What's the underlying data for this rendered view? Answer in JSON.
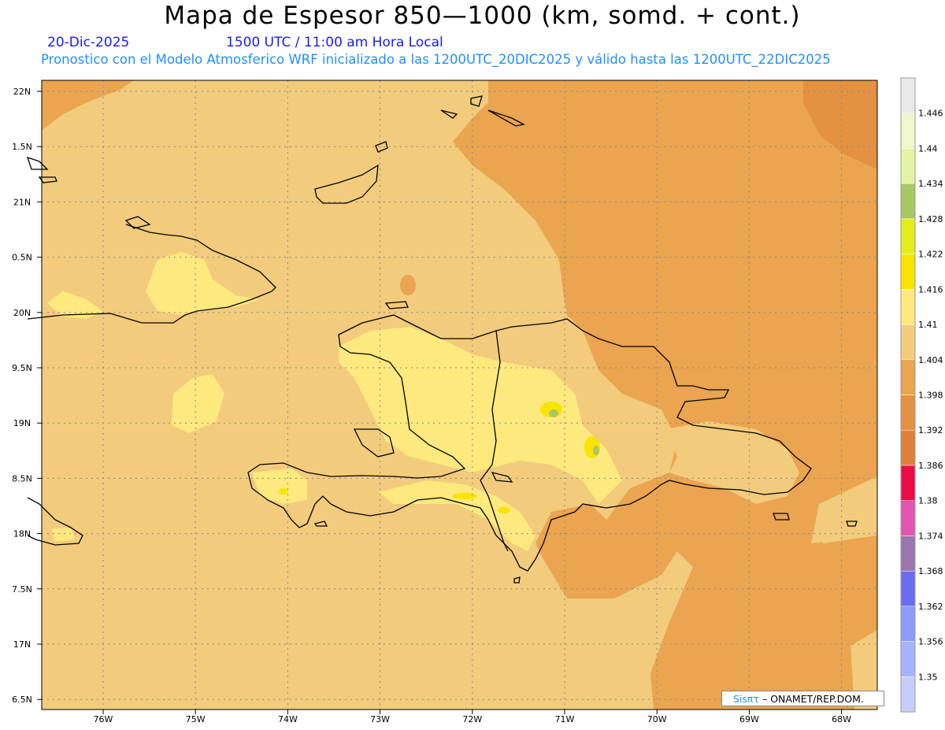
{
  "title": "Mapa de Espesor 850—1000 (km, somd. + cont.)",
  "date": "20-Dic-2025",
  "time": "1500 UTC / 11:00 am Hora Local",
  "description": "Pronostico con el Modelo Atmosferico WRF inicializado a las 1200UTC_20DIC2025 y válido hasta las  1200UTC_22DIC2025",
  "credit": {
    "prefix": "Sisπτ",
    "suffix": "– ONAMET/REP.DOM."
  },
  "map": {
    "lat_labels": [
      "22N",
      "1.5N",
      "21N",
      "0.5N",
      "20N",
      "9.5N",
      "19N",
      "8.5N",
      "18N",
      "7.5N",
      "17N",
      "6.5N"
    ],
    "lon_labels": [
      "76W",
      "75W",
      "74W",
      "73W",
      "72W",
      "71W",
      "70W",
      "69W",
      "68W"
    ]
  },
  "legend": {
    "levels": [
      "1.35",
      "1.356",
      "1.362",
      "1.368",
      "1.374",
      "1.38",
      "1.386",
      "1.392",
      "1.398",
      "1.404",
      "1.41",
      "1.416",
      "1.422",
      "1.428",
      "1.434",
      "1.44",
      "1.446"
    ],
    "colors": [
      "#c6cdfb",
      "#a5b4fd",
      "#8c9cfb",
      "#6b6bf3",
      "#9b75ad",
      "#e255b0",
      "#ea0d48",
      "#e07f3a",
      "#e39242",
      "#eba44f",
      "#f2cb7c",
      "#fde97e",
      "#f7e400",
      "#e4ed1b",
      "#a8c864",
      "#e4f3a4",
      "#f1f6cb",
      "#e9e9e9"
    ]
  },
  "colors": {
    "land_base": "#f2cb7c",
    "ocean_warm": "#eba44f",
    "ocean_warmer": "#e39242",
    "highland": "#fde97e",
    "peak": "#f7e400",
    "coast": "#000000"
  }
}
